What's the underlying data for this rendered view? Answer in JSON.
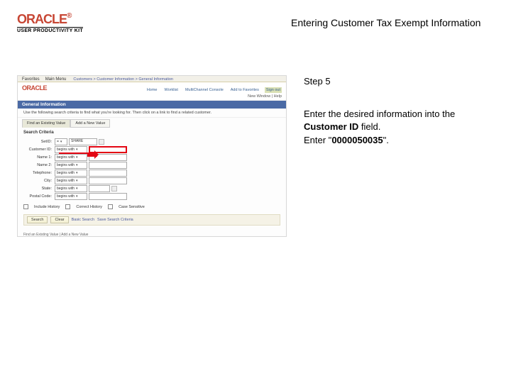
{
  "logo": {
    "brand": "ORACLE",
    "reg": "®",
    "product": "USER PRODUCTIVITY KIT"
  },
  "title": "Entering Customer Tax Exempt Information",
  "instructions": {
    "step_label": "Step 5",
    "line1a": "Enter the desired information into the ",
    "line1_field": "Customer ID",
    "line1b": " field.",
    "line2a": "Enter \"",
    "line2_value": "0000050035",
    "line2b": "\"."
  },
  "shot": {
    "nav": {
      "tab1": "Favorites",
      "tab2": "Main Menu",
      "crumb": "Customers  >  Customer Information  >  General Information"
    },
    "brand": "ORACLE",
    "subtabs": [
      "Home",
      "Worklist",
      "MultiChannel Console",
      "Add to Favorites",
      "Sign out"
    ],
    "status": "New Window | Help",
    "section": "General Information",
    "hint": "Use the following search criteria to find what you're looking for. Then click on a link to find a related customer.",
    "tabs2": {
      "a": "Find an Existing Value",
      "b": "Add a New Value"
    },
    "crit_head": "Search Criteria",
    "form": {
      "setid": {
        "label": "SetID:",
        "op": "=",
        "val": "SHARE"
      },
      "custid": {
        "label": "Customer ID:",
        "op": "begins with"
      },
      "name1": {
        "label": "Name 1:",
        "op": "begins with"
      },
      "name2": {
        "label": "Name 2:",
        "op": "begins with"
      },
      "telephone": {
        "label": "Telephone:",
        "op": "begins with"
      },
      "city": {
        "label": "City:",
        "op": "begins with"
      },
      "state": {
        "label": "State:",
        "op": "begins with"
      },
      "postal": {
        "label": "Postal Code:",
        "op": "begins with"
      }
    },
    "checks": {
      "a": "Include History",
      "b": "Correct History",
      "c": "Case Sensitive"
    },
    "actions": {
      "search": "Search",
      "clear": "Clear",
      "basic": "Basic Search",
      "save": "Save Search Criteria"
    },
    "footer": "Find an Existing Value | Add a New Value"
  }
}
